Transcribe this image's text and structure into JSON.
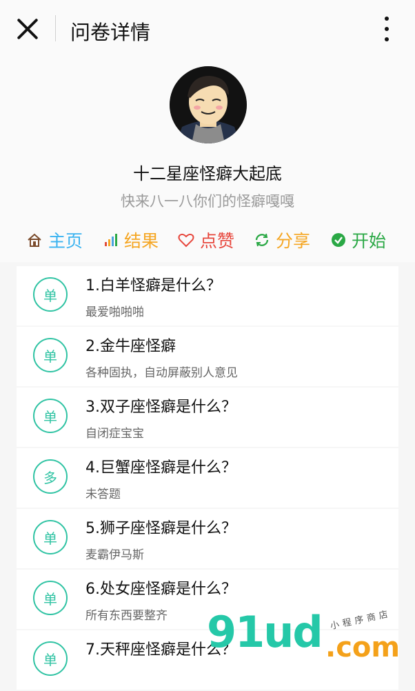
{
  "topbar": {
    "title": "问卷详情"
  },
  "survey": {
    "title": "十二星座怪癖大起底",
    "subtitle": "快来八一八你们的怪癖嘎嘎"
  },
  "actions": [
    {
      "label": "主页",
      "icon": "home-icon",
      "color": "#3bb3f0"
    },
    {
      "label": "结果",
      "icon": "bar-chart-icon",
      "color": "#f5a623"
    },
    {
      "label": "点赞",
      "icon": "heart-icon",
      "color": "#e7473d"
    },
    {
      "label": "分享",
      "icon": "refresh-icon",
      "color": "#f5a623"
    },
    {
      "label": "开始",
      "icon": "check-circle-icon",
      "color": "#2aa845"
    }
  ],
  "questions": [
    {
      "badge": "单",
      "question": "1.白羊怪癖是什么？",
      "answer": "最爱啪啪啪"
    },
    {
      "badge": "单",
      "question": "2.金牛座怪癖",
      "answer": "各种固执，自动屏蔽别人意见"
    },
    {
      "badge": "单",
      "question": "3.双子座怪癖是什么？",
      "answer": "自闭症宝宝"
    },
    {
      "badge": "多",
      "question": "4.巨蟹座怪癖是什么？",
      "answer": "未答题"
    },
    {
      "badge": "单",
      "question": "5.狮子座怪癖是什么？",
      "answer": "麦霸伊马斯"
    },
    {
      "badge": "单",
      "question": "6.处女座怪癖是什么？",
      "answer": "所有东西要整齐"
    },
    {
      "badge": "单",
      "question": "7.天秤座怪癖是什么？",
      "answer": ""
    }
  ],
  "watermark": {
    "big": "91ud",
    "com": ".com",
    "small": "小程序商店"
  },
  "colors": {
    "accent": "#2fc3a3"
  }
}
